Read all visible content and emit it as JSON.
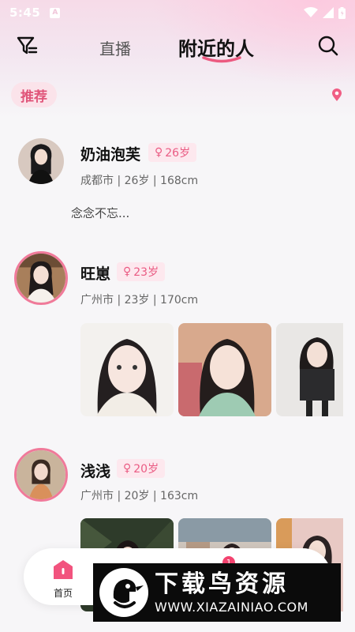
{
  "status_bar": {
    "time": "5:45",
    "notif_letter": "A"
  },
  "header": {
    "tab_live": "直播",
    "tab_nearby": "附近的人"
  },
  "filter": {
    "recommend_label": "推荐"
  },
  "users": [
    {
      "name": "奶油泡芙",
      "age": "26岁",
      "meta": "成都市 | 26岁 | 168cm",
      "motto": "念念不忘..."
    },
    {
      "name": "旺崽",
      "age": "23岁",
      "meta": "广州市 | 23岁 | 170cm"
    },
    {
      "name": "浅浅",
      "age": "20岁",
      "meta": "广州市 | 20岁 | 163cm"
    }
  ],
  "bottom_nav": {
    "home_label": "首页",
    "message_badge": "1"
  },
  "watermark": {
    "title": "下载鸟资源",
    "url": "WWW.XIAZAINIAO.COM"
  },
  "colors": {
    "accent": "#ea5b83",
    "badge_bg": "#fde8ee"
  }
}
